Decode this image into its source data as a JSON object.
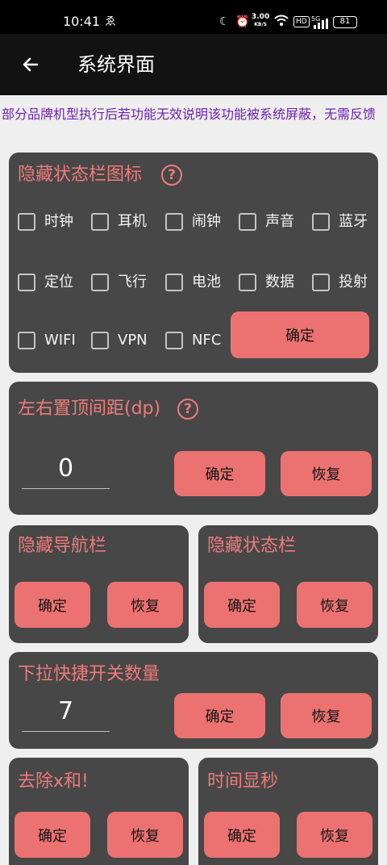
{
  "status_bar": {
    "time": "10:41",
    "net_speed": "3.00",
    "net_unit": "KB/S",
    "hd": "HD",
    "signal": "5G",
    "battery": "81"
  },
  "toolbar": {
    "back_icon": "arrow-left-icon",
    "title": "系统界面"
  },
  "notice": "部分品牌机型执行后若功能无效说明该功能被系统屏蔽，无需反馈",
  "hide_icons": {
    "title": "隐藏状态栏图标",
    "help_glyph": "?",
    "options": [
      "时钟",
      "耳机",
      "闹钟",
      "声音",
      "蓝牙",
      "定位",
      "飞行",
      "电池",
      "数据",
      "投射",
      "WIFI",
      "VPN",
      "NFC"
    ],
    "confirm": "确定"
  },
  "margin": {
    "title": "左右置顶间距(dp)",
    "help_glyph": "?",
    "value": "0",
    "confirm": "确定",
    "restore": "恢复"
  },
  "hide_nav": {
    "title": "隐藏导航栏",
    "confirm": "确定",
    "restore": "恢复"
  },
  "hide_status": {
    "title": "隐藏状态栏",
    "confirm": "确定",
    "restore": "恢复"
  },
  "quick_count": {
    "title": "下拉快捷开关数量",
    "value": "7",
    "confirm": "确定",
    "restore": "恢复"
  },
  "remove_x": {
    "title": "去除x和!",
    "confirm": "确定",
    "restore": "恢复"
  },
  "show_seconds": {
    "title": "时间显秒",
    "confirm": "确定",
    "restore": "恢复"
  },
  "colors": {
    "accent": "#ec7272",
    "card": "#474747",
    "notice_text": "#6f1fb5",
    "background": "#efefef"
  }
}
